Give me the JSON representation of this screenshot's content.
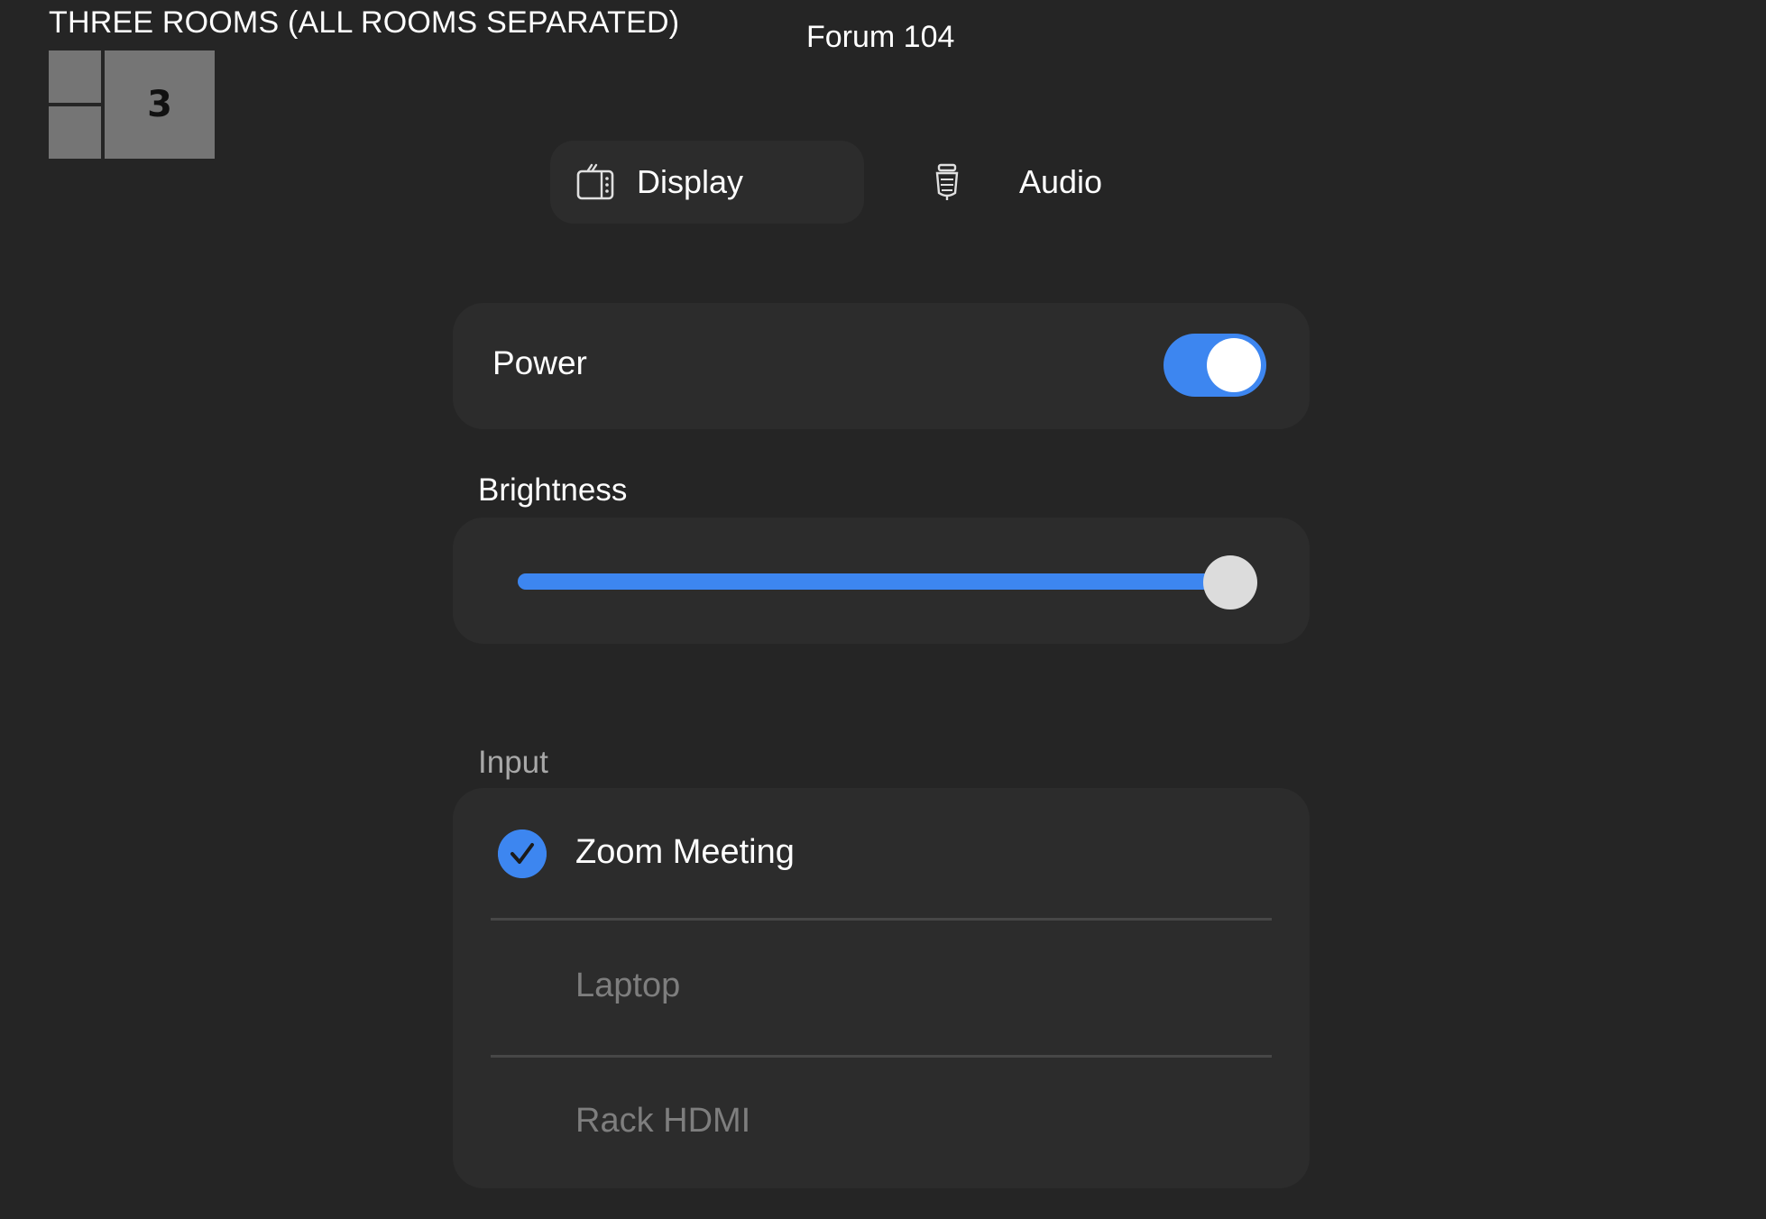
{
  "room_mode": {
    "title": "THREE ROOMS (ALL ROOMS SEPARATED)",
    "current_room_number": "3"
  },
  "room": {
    "name": "Forum 104"
  },
  "tabs": [
    {
      "label": "Display",
      "icon": "tv-icon",
      "active": true
    },
    {
      "label": "Audio",
      "icon": "microphone-icon",
      "active": false
    }
  ],
  "power": {
    "label": "Power",
    "on": true
  },
  "brightness": {
    "label": "Brightness",
    "level": 1.0
  },
  "input": {
    "label": "Input",
    "options": [
      {
        "label": "Zoom Meeting",
        "selected": true
      },
      {
        "label": "Laptop",
        "selected": false
      },
      {
        "label": "Rack HDMI",
        "selected": false
      }
    ]
  },
  "colors": {
    "background": "#252525",
    "card": "#2c2c2c",
    "accent": "#3d86f0",
    "muted_text": "#7e7e7e"
  }
}
